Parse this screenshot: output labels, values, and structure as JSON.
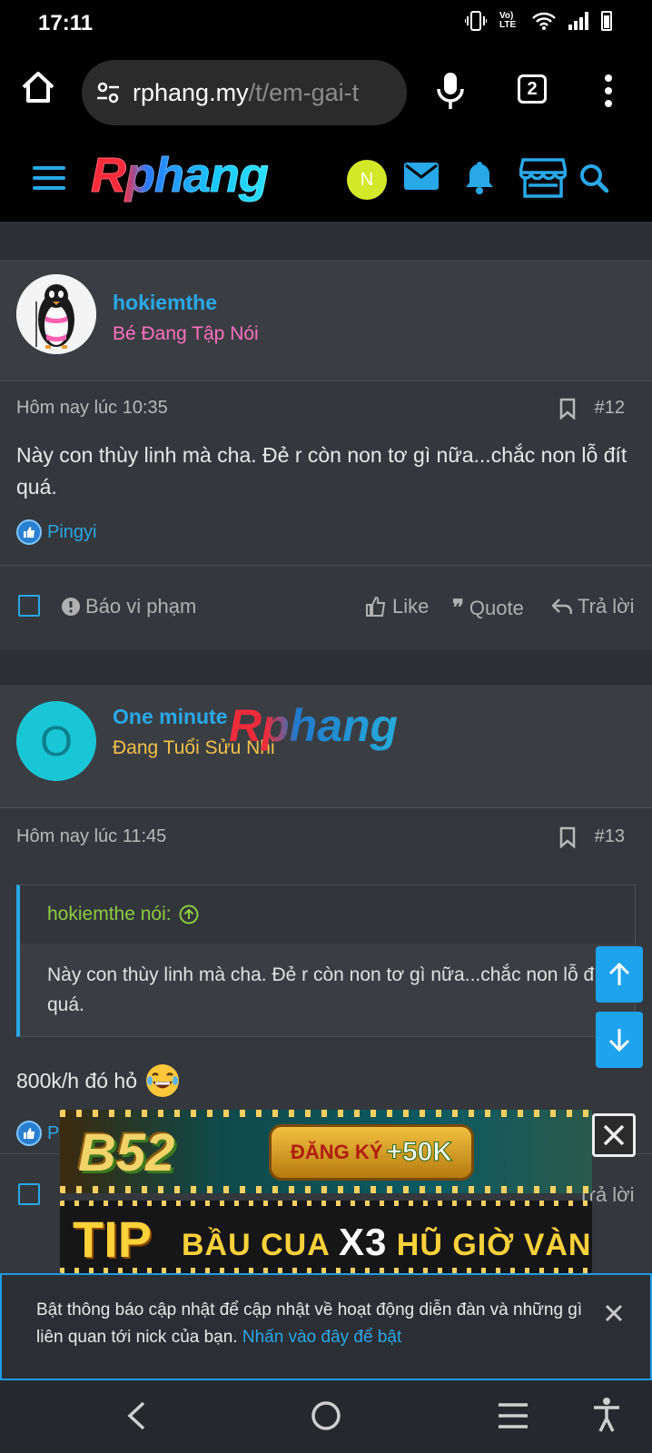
{
  "status_bar": {
    "time": "17:11",
    "lte_label": "Vo) LTE"
  },
  "browser": {
    "url_domain": "rphang.my",
    "url_path": "/t/em-gai-t",
    "tab_count": "2"
  },
  "site": {
    "logo": "Rphang",
    "user_initial": "N"
  },
  "posts": [
    {
      "username": "hokiemthe",
      "user_title": "Bé Đang Tập Nói",
      "user_title_color": "#ff6fc0",
      "date": "Hôm nay lúc 10:35",
      "number": "#12",
      "body": "Này con thùy linh mà cha. Đẻ r còn non tơ gì nữa...chắc non lỗ đít quá.",
      "reaction_user": "Pingyi",
      "actions": {
        "report": "Báo vi phạm",
        "like": "Like",
        "quote": "Quote",
        "reply": "Trả lời"
      }
    },
    {
      "username": "One minute",
      "avatar_letter": "O",
      "user_title": "Đang Tuổi Sửu Nhi",
      "user_title_color": "#f5c14a",
      "date": "Hôm nay lúc 11:45",
      "number": "#13",
      "quote_author": "hokiemthe nói:",
      "quote_text": "Này con thùy linh mà cha. Đẻ r còn non tơ gì nữa...chắc non lỗ đít quá.",
      "body": "800k/h đó hỏ",
      "reaction_user": "P",
      "actions": {
        "reply": "Trả lời"
      }
    }
  ],
  "watermark": "Rphang",
  "ads": {
    "b52_brand": "B52",
    "b52_cta_prefix": "ĐĂNG KÝ",
    "b52_cta_bonus": "+50K",
    "tip_brand": "TIP",
    "tip_text_a": "BẦU CUA",
    "tip_text_x": "X3",
    "tip_text_b": "HŨ GIỜ VÀNG"
  },
  "notification": {
    "text": "Bật thông báo cập nhật để cập nhật về hoạt động diễn đàn và những gì liên quan tới nick của bạn.",
    "link": "Nhấn vào đây để bật"
  },
  "colors": {
    "accent": "#29a8e8",
    "scroll_button": "#1ea3ef",
    "quote_author": "#8dcb41"
  }
}
